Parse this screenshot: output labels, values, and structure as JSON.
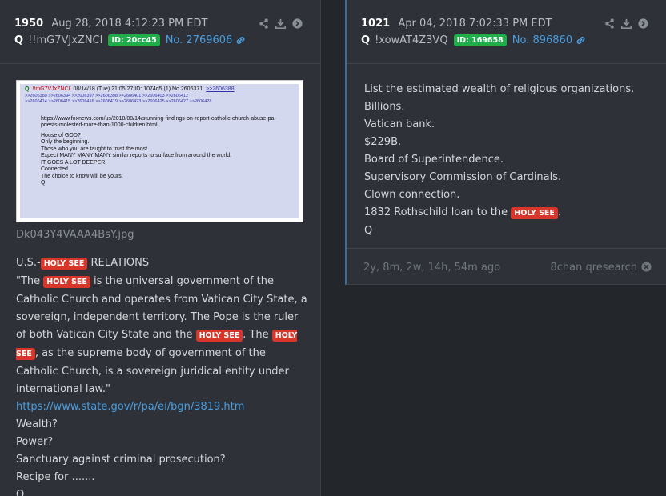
{
  "post1": {
    "number": "1950",
    "date": "Aug 28, 2018 4:12:23 PM EDT",
    "author": "Q",
    "tripcode": "!!mG7VJxZNCI",
    "id_badge": "ID: 20cc45",
    "post_no": "No. 2769606",
    "image": {
      "header_author": "Q",
      "header_trip": "!!mG7VJxZNCI",
      "header_meta": "08/14/18 (Tue) 21:05:27 ID: 1074d5 (1) No.2606371",
      "header_ref": ">>2606388",
      "refs_line1": ">>2606389 >>2606394 >>2606397 >>2606398 >>2606401 >>2606403 >>2606412",
      "refs_line2": ">>2606414 >>2606415 >>2606416 >>2606419 >>2606423 >>2606425 >>2606427 >>2606428",
      "url": "https://www.foxnews.com/us/2018/08/14/stunning-findings-on-report-catholic-church-abuse-pa-priests-molested-more-than-1000-children.html",
      "lines": [
        "House of GOD?",
        "Only the beginning.",
        "Those who you are taught to trust the most...",
        "Expect MANY MANY MANY similar reports to surface from around the world.",
        "IT GOES A LOT DEEPER.",
        "Connected.",
        "The choice to know will be yours.",
        "Q"
      ],
      "filename": "Dk043Y4VAAA4BsY.jpg"
    },
    "text": {
      "p1_a": "U.S.-",
      "p1_b": " RELATIONS",
      "p2_a": "\"The ",
      "p2_b": " is the universal government of the Catholic Church and operates from Vatican City State, a sovereign, independent territory. The Pope is the ruler of both Vatican City State and the ",
      "p2_c": ". The ",
      "p2_d": ", as the supreme body of government of the Catholic Church, is a sovereign juridical entity under international law.\"",
      "url": "https://www.state.gov/r/pa/ei/bgn/3819.htm",
      "l1": "Wealth?",
      "l2": "Power?",
      "l3": "Sanctuary against criminal prosecution?",
      "l4": "Recipe for .......",
      "l5": "Q"
    }
  },
  "post2": {
    "number": "1021",
    "date": "Apr 04, 2018 7:02:33 PM EDT",
    "author": "Q",
    "tripcode": "!xowAT4Z3VQ",
    "id_badge": "ID: 169658",
    "post_no": "No. 896860",
    "lines": [
      "List the estimated wealth of religious organizations.",
      "Billions.",
      "Vatican bank.",
      "$229B.",
      "Board of Superintendence.",
      "Supervisory Commission of Cardinals.",
      "Clown connection."
    ],
    "last_line_a": "1832 Rothschild loan to the ",
    "last_line_b": ".",
    "sign": "Q",
    "ago": "2y, 8m, 2w, 14h, 54m ago",
    "source": "8chan qresearch"
  },
  "highlight": "HOLY SEE",
  "icons": [
    "share-icon",
    "download-icon",
    "arrow-right-icon",
    "link-icon",
    "close-icon"
  ],
  "colors": {
    "background": "#23262b",
    "card": "#2e3238",
    "id_badge": "#1fae4a",
    "highlight": "#d9362b",
    "link": "#4a9de0"
  }
}
